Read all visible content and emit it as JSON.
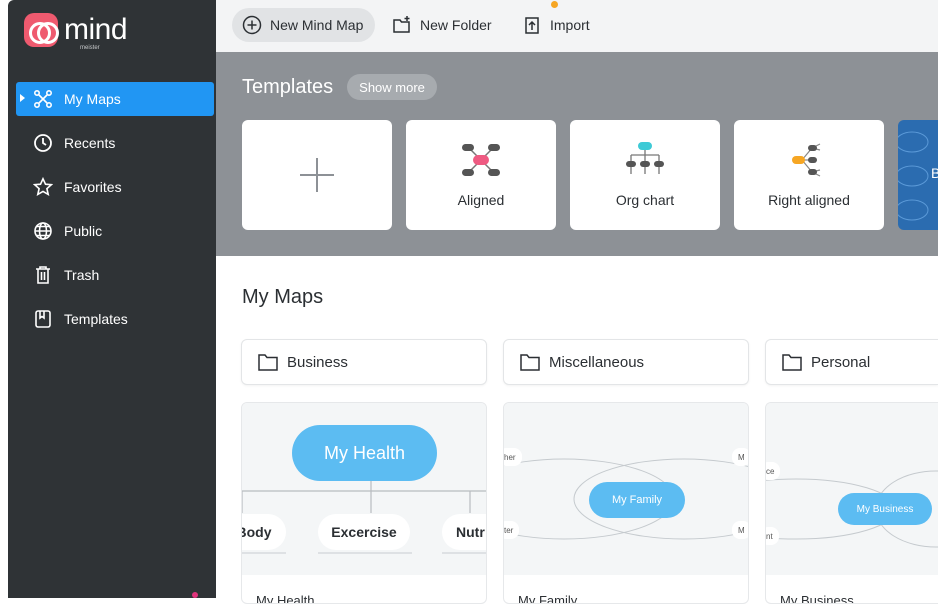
{
  "app": {
    "logo_text": "mind",
    "logo_subtext": "meister"
  },
  "sidebar": {
    "items": [
      {
        "label": "My Maps",
        "icon": "mindmap-icon",
        "active": true
      },
      {
        "label": "Recents",
        "icon": "clock-icon",
        "active": false
      },
      {
        "label": "Favorites",
        "icon": "star-icon",
        "active": false
      },
      {
        "label": "Public",
        "icon": "globe-icon",
        "active": false
      },
      {
        "label": "Trash",
        "icon": "trash-icon",
        "active": false
      },
      {
        "label": "Templates",
        "icon": "template-icon",
        "active": false
      }
    ]
  },
  "toolbar": {
    "new_map_label": "New Mind Map",
    "new_folder_label": "New Folder",
    "import_label": "Import"
  },
  "templates": {
    "title": "Templates",
    "show_more_label": "Show more",
    "cards": [
      {
        "label": ""
      },
      {
        "label": "Aligned"
      },
      {
        "label": "Org chart"
      },
      {
        "label": "Right aligned"
      },
      {
        "label": "B"
      }
    ]
  },
  "my_maps": {
    "title": "My Maps",
    "folders": [
      {
        "label": "Business"
      },
      {
        "label": "Miscellaneous"
      },
      {
        "label": "Personal"
      }
    ],
    "maps": [
      {
        "title": "My Health",
        "root": "My Health",
        "children": [
          "Body",
          "Excercise",
          "Nutr"
        ]
      },
      {
        "title": "My Family",
        "root": "My Family",
        "children": [
          "her",
          "ter",
          "M",
          "M"
        ]
      },
      {
        "title": "My Business",
        "root": "My Business",
        "children": [
          "ce",
          "nt"
        ]
      }
    ]
  },
  "colors": {
    "sidebar_bg": "#2f3336",
    "accent": "#2196f3",
    "brand": "#ef5a6f",
    "node_blue": "#5cbcf2",
    "templates_bg": "#8d9196"
  }
}
